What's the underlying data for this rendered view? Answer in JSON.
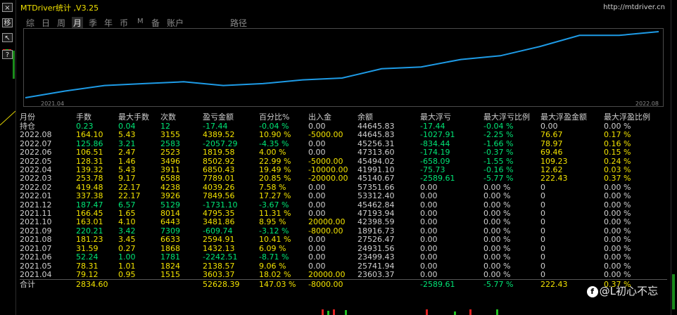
{
  "window": {
    "title": "MTDriver统计 ,V3.25",
    "url": "http://mtdriver.cn"
  },
  "left_strip": {
    "buttons": [
      "×",
      "移",
      "↖",
      "?"
    ]
  },
  "tabs": [
    {
      "label": "综",
      "active": false
    },
    {
      "label": "日",
      "active": false
    },
    {
      "label": "周",
      "active": false
    },
    {
      "label": "月",
      "active": true
    },
    {
      "label": "季",
      "active": false
    },
    {
      "label": "年",
      "active": false
    },
    {
      "label": "币",
      "active": false
    },
    {
      "label": "M",
      "active": false
    },
    {
      "label": "备",
      "active": false
    },
    {
      "label": "账户",
      "active": false
    },
    {
      "label": "路径",
      "active": false
    }
  ],
  "chart_data": {
    "type": "line",
    "x_start_label": "2021.04",
    "x_end_label": "2022.08",
    "series": [
      {
        "values": [
          -23603,
          -20000,
          -17000,
          -16000,
          -15000,
          -17000,
          -16000,
          -14000,
          -13000,
          -8000,
          -7000,
          -3000,
          -1000,
          4000,
          10000,
          10000,
          12000
        ]
      }
    ]
  },
  "table": {
    "headers": [
      "月份",
      "手数",
      "最大手数",
      "次数",
      "盈亏金额",
      "百分比%",
      "出入金",
      "余额",
      "最大浮亏",
      "最大浮亏比例",
      "最大浮盈金额",
      "最大浮盈比例"
    ],
    "holding": {
      "label": "持仓",
      "cells": [
        "0.23",
        "0.04",
        "12",
        "-17.44",
        "-0.04 %",
        "0.00",
        "44645.83",
        "-17.44",
        "-0.04 %",
        "0.00",
        "0.00 %"
      ]
    },
    "rows": [
      {
        "month": "2022.08",
        "cells": [
          "164.10",
          "5.43",
          "3155",
          "4389.52",
          "10.90 %",
          "-5000.00",
          "44645.83",
          "-1027.91",
          "-2.25 %",
          "76.67",
          "0.17 %"
        ],
        "colors": [
          "y",
          "y",
          "y",
          "y",
          "y",
          "y",
          "w",
          "g",
          "g",
          "y",
          "y"
        ]
      },
      {
        "month": "2022.07",
        "cells": [
          "125.86",
          "3.21",
          "2583",
          "-2057.29",
          "-4.35 %",
          "0.00",
          "45256.31",
          "-834.44",
          "-1.66 %",
          "78.97",
          "0.16 %"
        ],
        "colors": [
          "g",
          "g",
          "g",
          "g",
          "g",
          "w",
          "w",
          "g",
          "g",
          "y",
          "y"
        ]
      },
      {
        "month": "2022.06",
        "cells": [
          "106.51",
          "2.47",
          "2523",
          "1819.58",
          "4.00 %",
          "0.00",
          "47313.60",
          "-174.19",
          "-0.37 %",
          "69.46",
          "0.15 %"
        ],
        "colors": [
          "y",
          "y",
          "y",
          "y",
          "y",
          "w",
          "w",
          "g",
          "g",
          "y",
          "y"
        ]
      },
      {
        "month": "2022.05",
        "cells": [
          "128.31",
          "1.46",
          "3496",
          "8502.92",
          "22.99 %",
          "-5000.00",
          "45494.02",
          "-658.09",
          "-1.55 %",
          "109.23",
          "0.24 %"
        ],
        "colors": [
          "y",
          "y",
          "y",
          "y",
          "y",
          "y",
          "w",
          "g",
          "g",
          "y",
          "y"
        ]
      },
      {
        "month": "2022.04",
        "cells": [
          "139.32",
          "5.43",
          "3911",
          "6850.43",
          "19.49 %",
          "-10000.00",
          "41991.10",
          "-75.73",
          "-0.16 %",
          "12.62",
          "0.03 %"
        ],
        "colors": [
          "y",
          "y",
          "y",
          "y",
          "y",
          "y",
          "w",
          "g",
          "g",
          "y",
          "y"
        ]
      },
      {
        "month": "2022.03",
        "cells": [
          "253.78",
          "9.17",
          "6588",
          "7789.01",
          "20.85 %",
          "-20000.00",
          "45140.67",
          "-2589.61",
          "-5.77 %",
          "222.43",
          "0.37 %"
        ],
        "colors": [
          "y",
          "y",
          "y",
          "y",
          "y",
          "y",
          "w",
          "g",
          "g",
          "y",
          "y"
        ]
      },
      {
        "month": "2022.02",
        "cells": [
          "419.48",
          "22.17",
          "4238",
          "4039.26",
          "7.58 %",
          "0.00",
          "57351.66",
          "0.00",
          "0.00 %",
          "0",
          "0.00 %"
        ],
        "colors": [
          "y",
          "y",
          "y",
          "y",
          "y",
          "w",
          "w",
          "w",
          "w",
          "w",
          "w"
        ]
      },
      {
        "month": "2022.01",
        "cells": [
          "337.38",
          "22.17",
          "3926",
          "7849.56",
          "17.27 %",
          "0.00",
          "53312.40",
          "0.00",
          "0.00 %",
          "0",
          "0.00 %"
        ],
        "colors": [
          "y",
          "y",
          "y",
          "y",
          "y",
          "w",
          "w",
          "w",
          "w",
          "w",
          "w"
        ]
      },
      {
        "month": "2021.12",
        "cells": [
          "187.47",
          "6.57",
          "5129",
          "-1731.10",
          "-3.67 %",
          "0.00",
          "45462.84",
          "0.00",
          "0.00 %",
          "0",
          "0.00 %"
        ],
        "colors": [
          "g",
          "g",
          "g",
          "g",
          "g",
          "w",
          "w",
          "w",
          "w",
          "w",
          "w"
        ]
      },
      {
        "month": "2021.11",
        "cells": [
          "166.45",
          "1.65",
          "8014",
          "4795.35",
          "11.31 %",
          "0.00",
          "47193.94",
          "0.00",
          "0.00 %",
          "0",
          "0.00 %"
        ],
        "colors": [
          "y",
          "y",
          "y",
          "y",
          "y",
          "w",
          "w",
          "w",
          "w",
          "w",
          "w"
        ]
      },
      {
        "month": "2021.10",
        "cells": [
          "163.01",
          "4.10",
          "6443",
          "3481.86",
          "8.95 %",
          "20000.00",
          "42398.59",
          "0.00",
          "0.00 %",
          "0",
          "0.00 %"
        ],
        "colors": [
          "y",
          "y",
          "y",
          "y",
          "y",
          "y",
          "w",
          "w",
          "w",
          "w",
          "w"
        ]
      },
      {
        "month": "2021.09",
        "cells": [
          "220.21",
          "3.42",
          "7309",
          "-609.74",
          "-3.12 %",
          "-8000.00",
          "18916.73",
          "0.00",
          "0.00 %",
          "0",
          "0.00 %"
        ],
        "colors": [
          "g",
          "g",
          "g",
          "g",
          "g",
          "y",
          "w",
          "w",
          "w",
          "w",
          "w"
        ]
      },
      {
        "month": "2021.08",
        "cells": [
          "181.23",
          "3.45",
          "6633",
          "2594.91",
          "10.41 %",
          "0.00",
          "27526.47",
          "0.00",
          "0.00 %",
          "0",
          "0.00 %"
        ],
        "colors": [
          "y",
          "y",
          "y",
          "y",
          "y",
          "w",
          "w",
          "w",
          "w",
          "w",
          "w"
        ]
      },
      {
        "month": "2021.07",
        "cells": [
          "31.59",
          "0.27",
          "1868",
          "1432.13",
          "6.09 %",
          "0.00",
          "24931.56",
          "0.00",
          "0.00 %",
          "0",
          "0.00 %"
        ],
        "colors": [
          "y",
          "y",
          "y",
          "y",
          "y",
          "w",
          "w",
          "w",
          "w",
          "w",
          "w"
        ]
      },
      {
        "month": "2021.06",
        "cells": [
          "52.24",
          "1.00",
          "1781",
          "-2242.51",
          "-8.71 %",
          "0.00",
          "23499.43",
          "0.00",
          "0.00 %",
          "0",
          "0.00 %"
        ],
        "colors": [
          "g",
          "g",
          "g",
          "g",
          "g",
          "w",
          "w",
          "w",
          "w",
          "w",
          "w"
        ]
      },
      {
        "month": "2021.05",
        "cells": [
          "78.31",
          "1.01",
          "1824",
          "2138.57",
          "9.06 %",
          "0.00",
          "25741.94",
          "0.00",
          "0.00 %",
          "0",
          "0.00 %"
        ],
        "colors": [
          "y",
          "y",
          "y",
          "y",
          "y",
          "w",
          "w",
          "w",
          "w",
          "w",
          "w"
        ]
      },
      {
        "month": "2021.04",
        "cells": [
          "79.12",
          "0.95",
          "1515",
          "3603.37",
          "18.02 %",
          "20000.00",
          "23603.37",
          "0.00",
          "0.00 %",
          "0",
          "0.00 %"
        ],
        "colors": [
          "y",
          "y",
          "y",
          "y",
          "y",
          "y",
          "w",
          "w",
          "w",
          "w",
          "w"
        ]
      }
    ],
    "total": {
      "label": "合计",
      "cells": [
        "2834.60",
        "",
        "",
        "52628.39",
        "147.03 %",
        "-8000.00",
        "",
        "-2589.61",
        "-5.77 %",
        "222.43",
        "0.37 %"
      ]
    }
  },
  "watermark": {
    "text": "@L初心不忘"
  },
  "colors": {
    "yellow": "#f2e200",
    "green": "#00e676",
    "line": "#1e9be6",
    "border": "#4a4a4a"
  }
}
